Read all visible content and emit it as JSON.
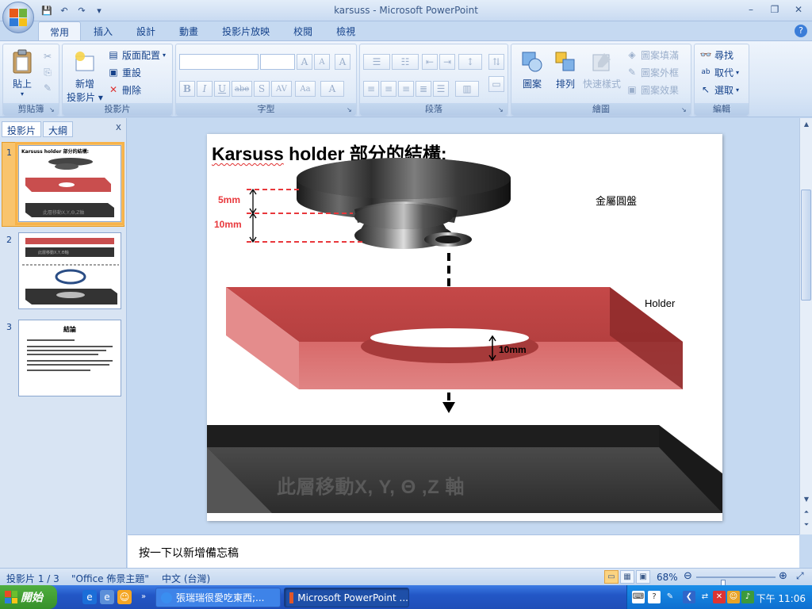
{
  "window": {
    "title": "karsuss - Microsoft PowerPoint",
    "min": "–",
    "max": "❐",
    "close": "✕"
  },
  "qat": [
    "💾",
    "↶",
    "↷",
    "▾"
  ],
  "tabs": [
    "常用",
    "插入",
    "設計",
    "動畫",
    "投影片放映",
    "校閱",
    "檢視"
  ],
  "help": "?",
  "ribbon": {
    "clipboard": {
      "label": "剪貼簿",
      "paste": "貼上",
      "cut_icon": "✂",
      "copy_icon": "⎘",
      "format_icon": "✎"
    },
    "slides": {
      "label": "投影片",
      "new_slide": "新增",
      "new_slide2": "投影片",
      "layout": "版面配置",
      "reset": "重設",
      "delete": "刪除"
    },
    "font": {
      "label": "字型",
      "grow": "A",
      "shrink": "A",
      "clear": "A",
      "bold": "B",
      "italic": "I",
      "underline": "U",
      "strike": "abe",
      "shadow": "S",
      "spacing": "AV",
      "case": "Aa",
      "color": "A"
    },
    "paragraph": {
      "label": "段落"
    },
    "drawing": {
      "label": "繪圖",
      "shapes": "圖案",
      "arrange": "排列",
      "quick_styles": "快速樣式",
      "fill": "圖案填滿",
      "outline": "圖案外框",
      "effects": "圖案效果"
    },
    "editing": {
      "label": "編輯",
      "find": "尋找",
      "replace": "取代",
      "select": "選取"
    }
  },
  "pane": {
    "tab_slides": "投影片",
    "tab_outline": "大綱",
    "close": "x",
    "thumbs": [
      {
        "num": "1",
        "title": "Karsuss holder 部分的結構:"
      },
      {
        "num": "2",
        "caption": "此層移動X,Y,Θ軸"
      },
      {
        "num": "3",
        "title": "結論"
      }
    ]
  },
  "slide": {
    "title_word": "Karsuss",
    "title_rest": " holder 部分的結構:",
    "label_disk": "金屬圓盤",
    "label_holder": "Holder",
    "dim_5": "5mm",
    "dim_10": "10mm",
    "dim_hole": "10mm",
    "axis_text": "此層移動X, Y, Θ ,Z 軸"
  },
  "notes_placeholder": "按一下以新增備忘稿",
  "status": {
    "slide": "投影片 1 / 3",
    "theme": "\"Office 佈景主題\"",
    "lang": "中文 (台灣)",
    "zoom": "68%",
    "zoom_level": 0.68
  },
  "taskbar": {
    "start": "開始",
    "tasks": [
      {
        "label": "張瑞瑞很愛吃東西;...",
        "active": false
      },
      {
        "label": "Microsoft PowerPoint ...",
        "active": true
      }
    ],
    "clock": "下午 11:06"
  },
  "colors": {
    "accent": "#15428b",
    "holder_red": "#c94e4e",
    "dim_red": "#e8383c"
  }
}
